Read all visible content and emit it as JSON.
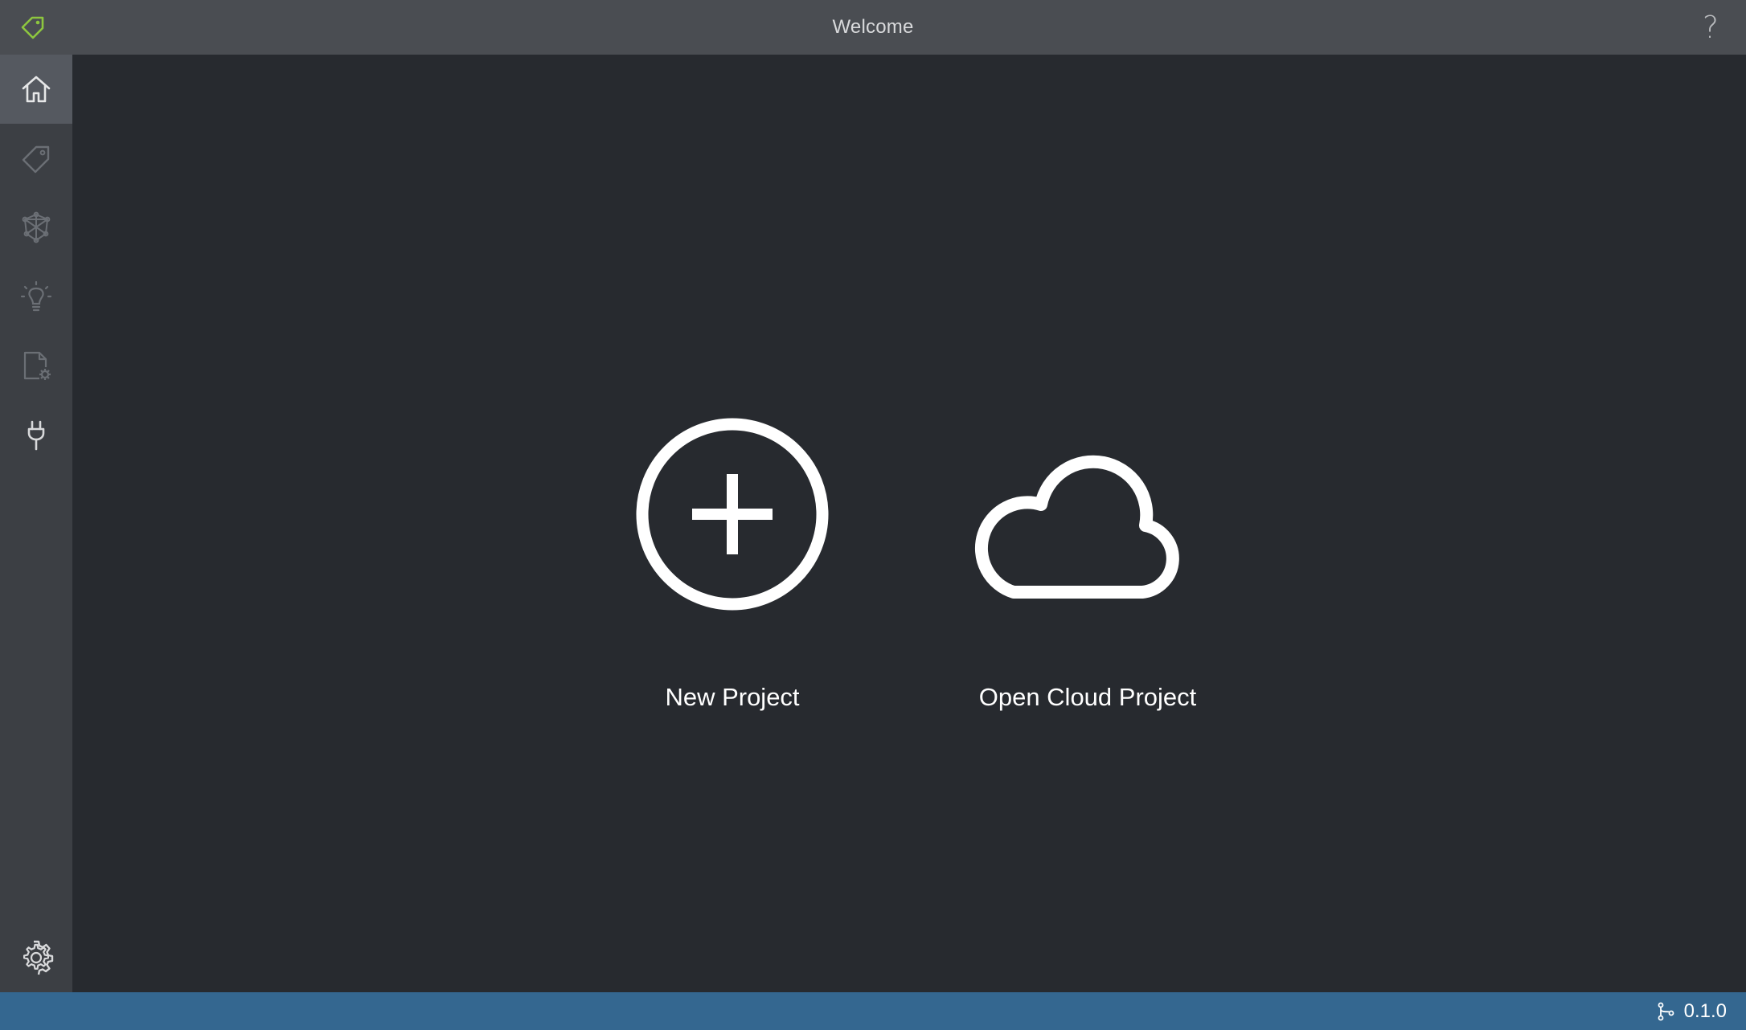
{
  "window": {
    "title": "Welcome",
    "help_label": "?",
    "logo_icon": "tag-logo-icon"
  },
  "sidebar": {
    "items": [
      {
        "id": "home",
        "icon": "home-icon",
        "active": true
      },
      {
        "id": "tags",
        "icon": "tag-icon",
        "active": false
      },
      {
        "id": "model",
        "icon": "network-icon",
        "active": false
      },
      {
        "id": "insights",
        "icon": "lightbulb-icon",
        "active": false
      },
      {
        "id": "export",
        "icon": "file-gear-icon",
        "active": false
      },
      {
        "id": "connections",
        "icon": "plug-icon",
        "active": false
      }
    ],
    "settings_icon": "gear-icon"
  },
  "main": {
    "actions": [
      {
        "label": "New Project",
        "icon": "plus-circle-icon"
      },
      {
        "label": "Open Cloud Project",
        "icon": "cloud-icon"
      }
    ]
  },
  "status": {
    "version": "0.1.0",
    "icon": "branch-icon"
  },
  "colors": {
    "titlebar": "#4a4d52",
    "sidebar": "#3c3f44",
    "sidebar_active": "#555960",
    "main": "#272a2f",
    "statusbar": "#346790",
    "logo_accent": "#8dc63f"
  }
}
